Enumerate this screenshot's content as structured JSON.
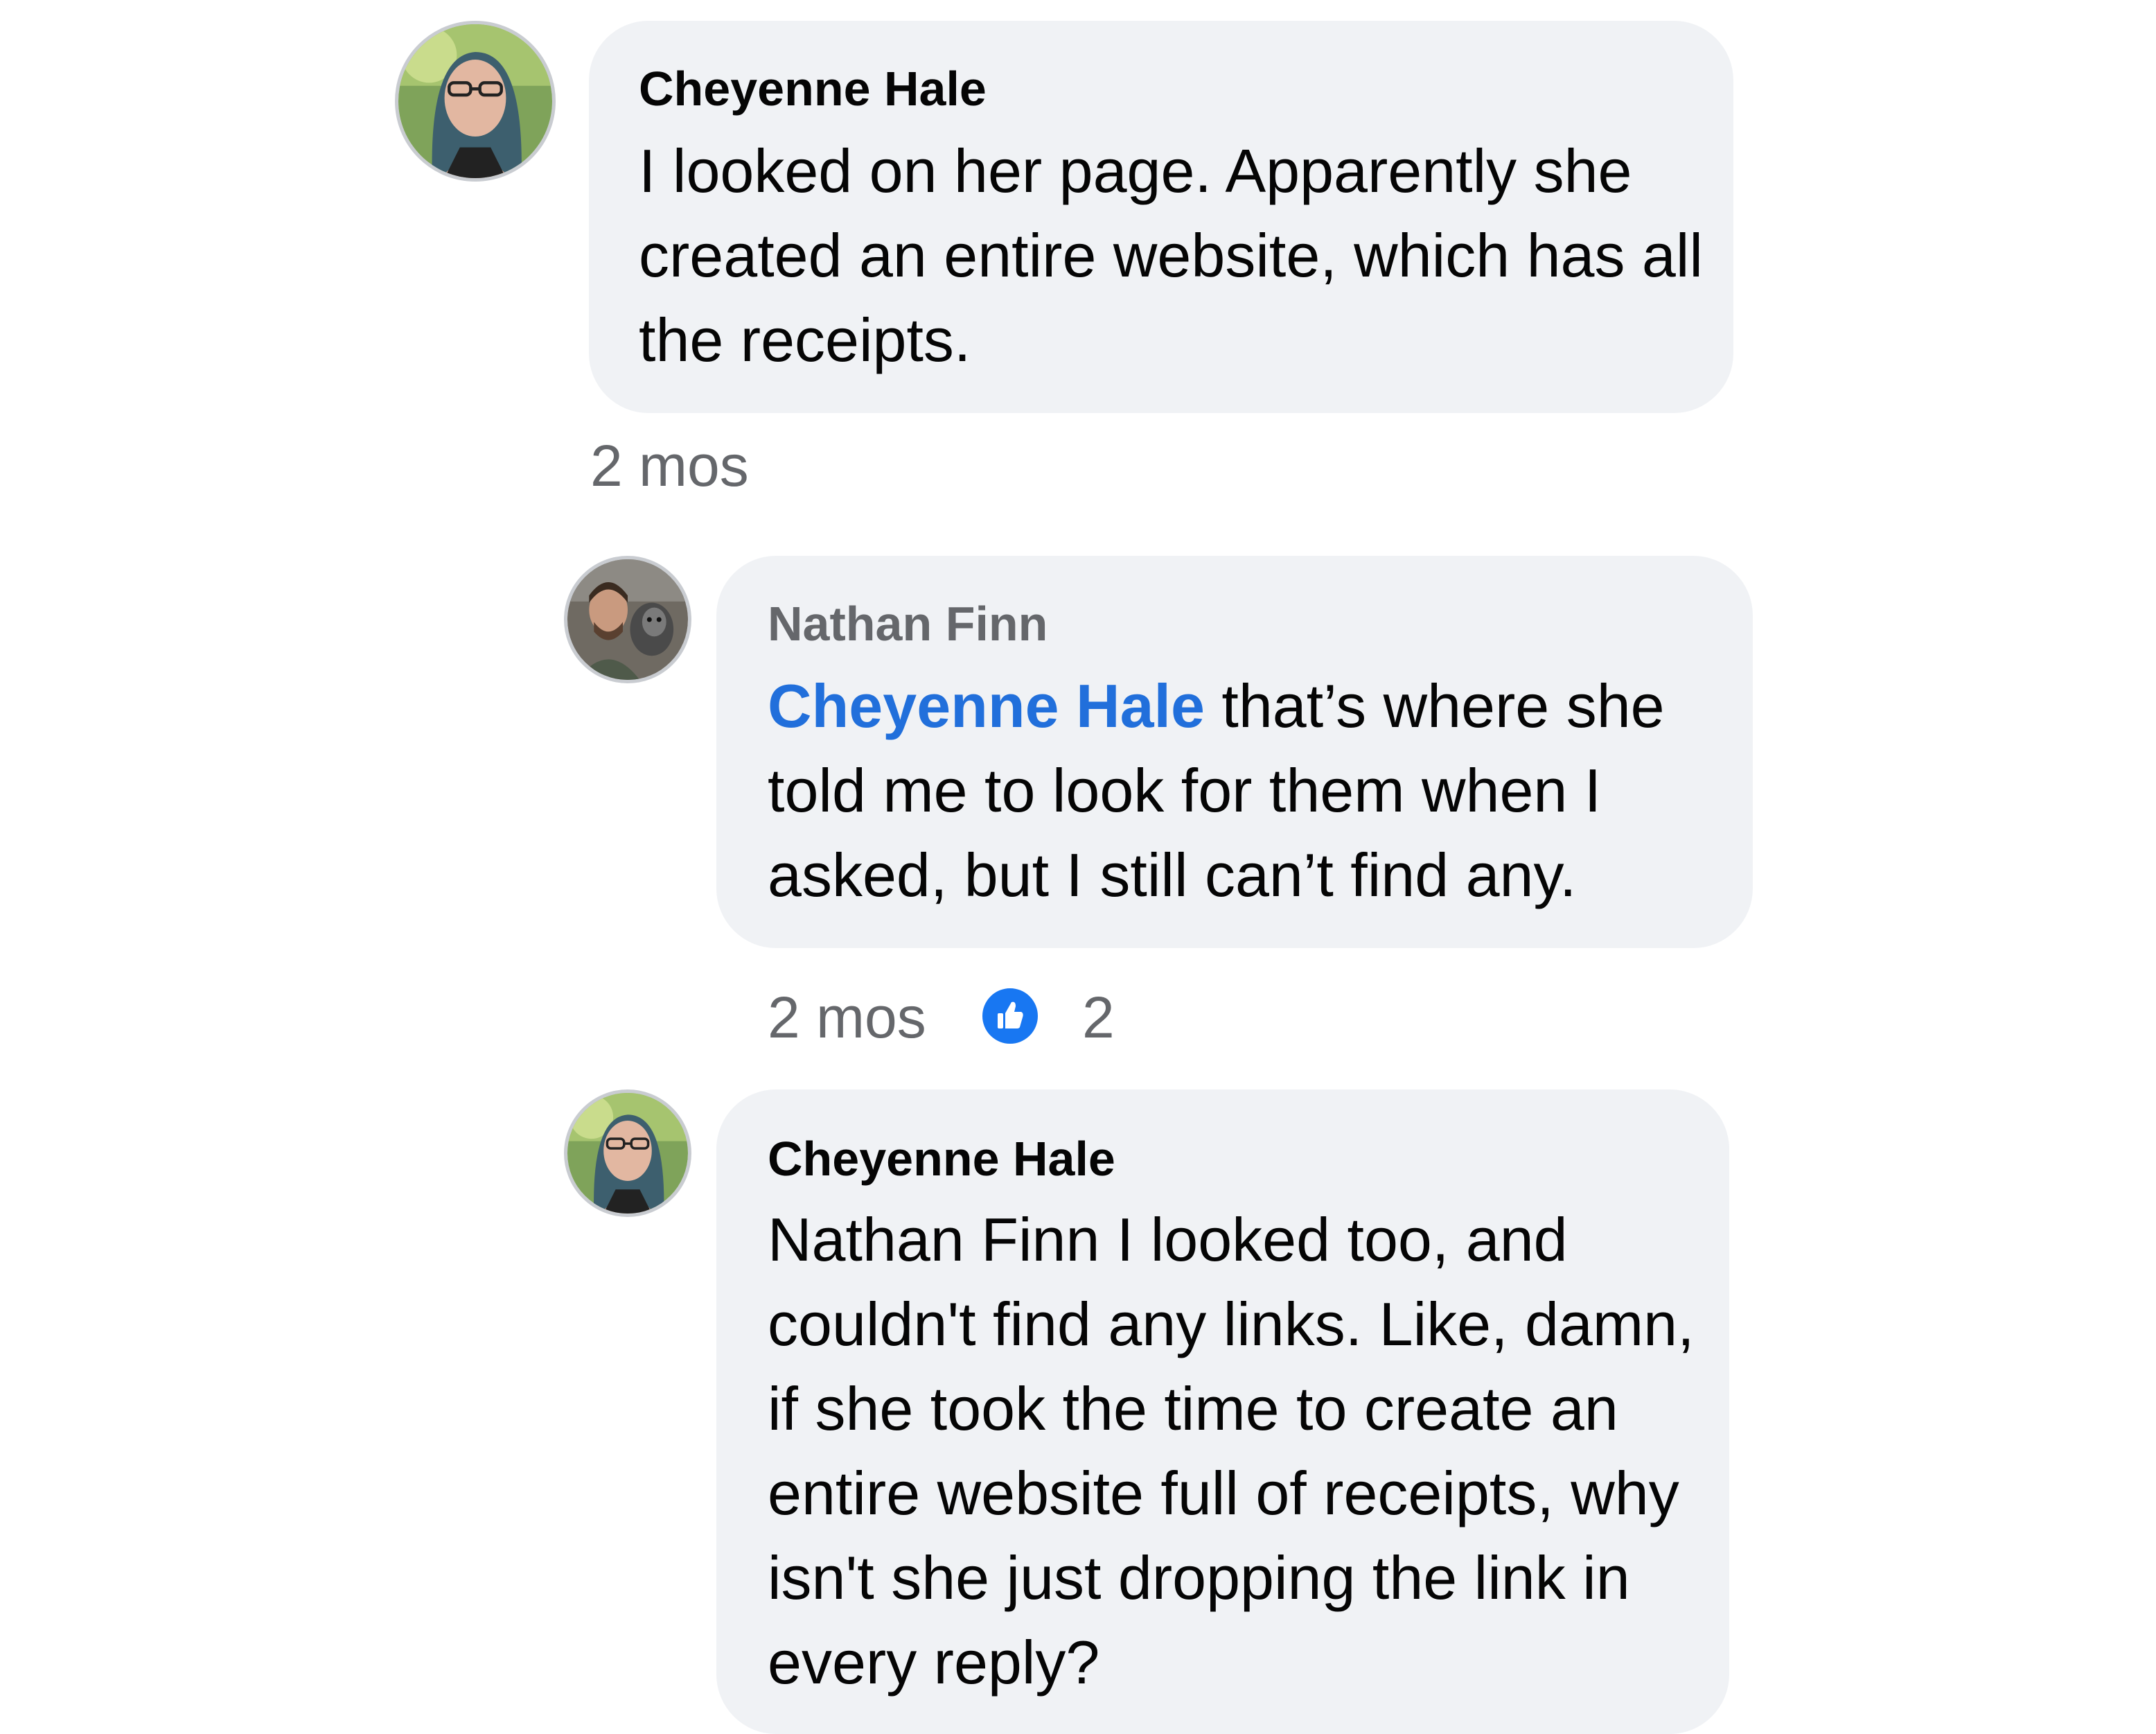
{
  "comments": [
    {
      "author": "Cheyenne Hale",
      "text": "I looked on her page. Apparently she created an entire website, which has all the receipts.",
      "time": "2 mos"
    },
    {
      "author": "Nathan Finn",
      "mention": "Cheyenne Hale",
      "text": "that’s where she told me to look for them when I asked, but I still can’t find any.",
      "time": "2 mos",
      "reaction_icon": "like-icon",
      "reaction_count": "2"
    },
    {
      "author": "Cheyenne Hale",
      "text": "Nathan Finn I looked too, and couldn't find any links. Like, damn, if she took the time to create an entire website full of receipts, why isn't she just dropping the link in every reply?"
    }
  ],
  "colors": {
    "bubble": "#f0f2f5",
    "mention": "#216fdb",
    "meta_text": "#65676b",
    "like_badge": "#1877f2"
  }
}
